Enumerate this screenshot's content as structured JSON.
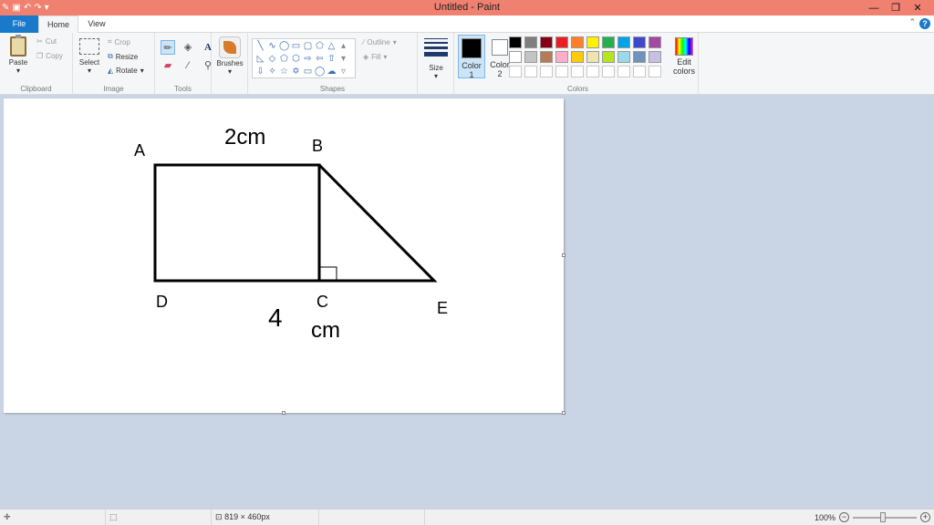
{
  "window": {
    "title": "Untitled - Paint",
    "controls": [
      "—",
      "❐",
      "✕"
    ]
  },
  "tabs": {
    "file": "File",
    "home": "Home",
    "view": "View"
  },
  "clipboard": {
    "paste": "Paste",
    "cut": "Cut",
    "copy": "Copy",
    "label": "Clipboard"
  },
  "image": {
    "select": "Select",
    "crop": "Crop",
    "resize": "Resize",
    "rotate": "Rotate",
    "label": "Image"
  },
  "tools": {
    "label": "Tools"
  },
  "brushes": {
    "label": "Brushes"
  },
  "shapes": {
    "outline": "Outline",
    "fill": "Fill",
    "label": "Shapes"
  },
  "size": {
    "label": "Size"
  },
  "colors": {
    "color1": "Color",
    "color1_num": "1",
    "color2": "Color",
    "color2_num": "2",
    "edit": "Edit colors",
    "label": "Colors",
    "color1_value": "#000000",
    "color2_value": "#ffffff",
    "palette": [
      "#000000",
      "#7f7f7f",
      "#880015",
      "#ed1c24",
      "#ff7f27",
      "#fff200",
      "#22b14c",
      "#00a2e8",
      "#3f48cc",
      "#a349a4",
      "#ffffff",
      "#c3c3c3",
      "#b97a57",
      "#ffaec9",
      "#ffc90e",
      "#efe4b0",
      "#b5e61d",
      "#99d9ea",
      "#7092be",
      "#c8bfe7",
      "#ffffff",
      "#ffffff",
      "#ffffff",
      "#ffffff",
      "#ffffff",
      "#ffffff",
      "#ffffff",
      "#ffffff",
      "#ffffff",
      "#ffffff"
    ]
  },
  "drawing": {
    "labels": [
      "A",
      "B",
      "D",
      "C",
      "E"
    ],
    "top_measure": "2cm",
    "bottom_measure_num": "4",
    "bottom_measure_unit": "cm"
  },
  "status": {
    "canvas_size": "819 × 460px",
    "zoom": "100%"
  }
}
